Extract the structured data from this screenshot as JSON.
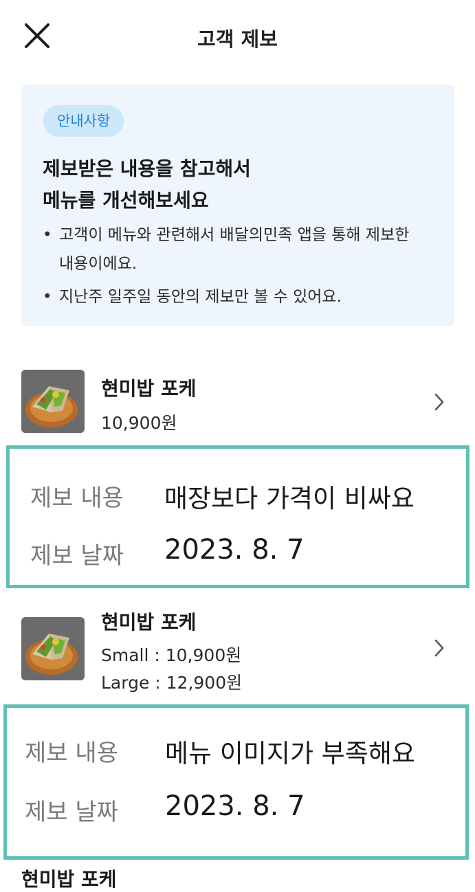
{
  "header": {
    "title": "고객 제보",
    "close_icon": "close-icon"
  },
  "notice": {
    "badge": "안내사항",
    "title_line1": "제보받은 내용을 참고해서",
    "title_line2": "메뉴를 개선해보세요",
    "bullets": [
      "고객이 메뉴와 관련해서 배달의민족 앱을 통해 제보한 내용이에요.",
      "지난주 일주일 동안의 제보만 볼 수 있어요."
    ]
  },
  "items": [
    {
      "name": "현미밥 포케",
      "price": "10,900원",
      "report": {
        "content_label": "제보 내용",
        "content": "매장보다 가격이 비싸요",
        "date_label": "제보 날짜",
        "date": "2023. 8. 7"
      }
    },
    {
      "name": "현미밥 포케",
      "price_small": "Small : 10,900원",
      "price_large": "Large : 12,900원",
      "report": {
        "content_label": "제보 내용",
        "content": "메뉴 이미지가 부족해요",
        "date_label": "제보 날짜",
        "date": "2023. 8. 7"
      }
    },
    {
      "name": "현미밥 포케"
    }
  ],
  "colors": {
    "accent_border": "#5ebfb7",
    "badge_bg": "#cde7fb",
    "badge_text": "#1a85d6",
    "notice_bg": "#eef5fc"
  }
}
